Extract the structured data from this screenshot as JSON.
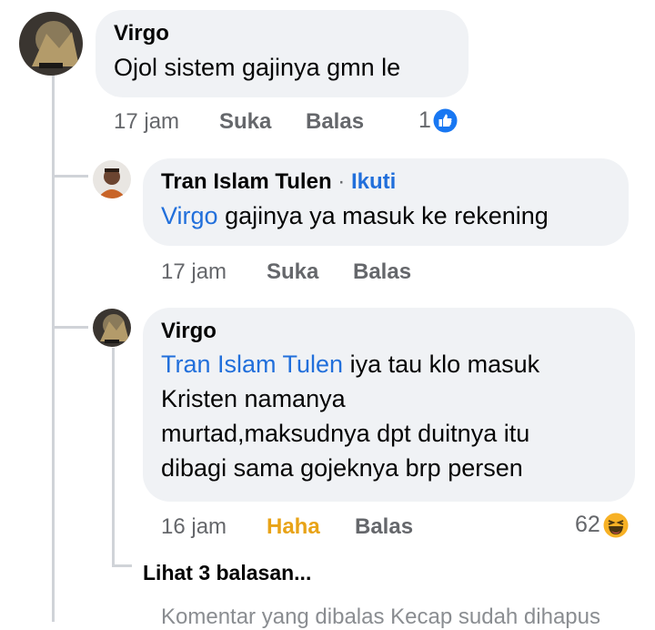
{
  "comments": [
    {
      "author": "Virgo",
      "text": "Ojol sistem gajinya gmn le",
      "time": "17 jam",
      "like_label": "Suka",
      "reply_label": "Balas",
      "reaction_count": "1",
      "reaction_icon": "like-icon"
    },
    {
      "author": "Tran Islam Tulen",
      "separator": "·",
      "follow_label": "Ikuti",
      "mention": "Virgo",
      "text": "gajinya ya masuk ke rekening",
      "time": "17 jam",
      "like_label": "Suka",
      "reply_label": "Balas"
    },
    {
      "author": "Virgo",
      "mention": "Tran Islam Tulen",
      "text_line1": "iya tau klo masuk",
      "text_line2": "Kristen namanya",
      "text_line3": "murtad,maksudnya dpt duitnya itu",
      "text_line4": "dibagi sama gojeknya brp persen",
      "time": "16 jam",
      "reaction_label": "Haha",
      "reply_label": "Balas",
      "reaction_count": "62",
      "reaction_icon": "haha-icon"
    }
  ],
  "view_more_replies": "Lihat 3 balasan...",
  "footer_note": "Komentar yang dibalas Kecap sudah dihapus",
  "colors": {
    "bubble": "#f0f2f5",
    "link": "#216fdb",
    "meta": "#65676b",
    "haha": "#e8a317",
    "like": "#1877f2"
  }
}
